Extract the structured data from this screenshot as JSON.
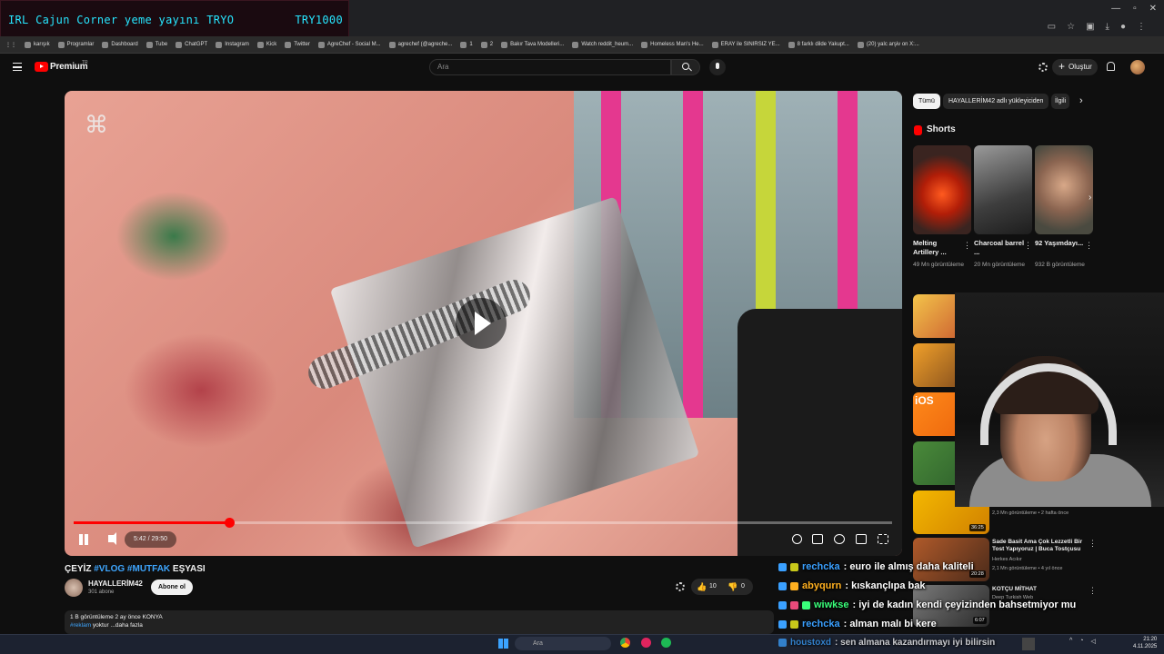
{
  "overlay_banner": {
    "left": "IRL Cajun Corner yeme yayını  TRYO",
    "right": "TRY1000"
  },
  "bookmarks": [
    "karışık",
    "Programlar",
    "Dashboard",
    "Tube",
    "ChatGPT",
    "Instagram",
    "Kick",
    "Twitter",
    "AgreChef - Social M...",
    "agrechef (@agreche...",
    "1",
    "2",
    "Bakır Tava Modelleri...",
    "Watch reddit_heum...",
    "Homeless Man's He...",
    "ERAY ile SINIRSIZ YE...",
    "8 farklı dilde Yakupt...",
    "(20) yalc arşiv on X:..."
  ],
  "yt": {
    "brand": "Premium",
    "region": "TR",
    "search_placeholder": "Ara",
    "create_label": "Oluştur"
  },
  "player": {
    "time": "5:42 / 29:50",
    "progress": 0.19
  },
  "video": {
    "title_prefix": "ÇEYİZ ",
    "tag1": "#VLOG",
    "tag2": "#MUTFAK",
    "title_suffix": " EŞYASI",
    "channel": "HAYALLERİM42",
    "subs": "301 abone",
    "subscribe": "Abone ol",
    "likes": "10",
    "dislikes": "0",
    "desc_line1": "1 B görüntüleme  2 ay önce  KONYA",
    "desc_tag": "#reklam",
    "desc_rest": " yoktur ...daha fazla"
  },
  "chips": [
    "Tümü",
    "HAYALLERİM42 adlı yükleyiciden",
    "İlgili"
  ],
  "shorts": {
    "title": "Shorts",
    "items": [
      {
        "title": "Melting Artillery ...",
        "views": "49 Mn görüntüleme"
      },
      {
        "title": "Charcoal barrel ...",
        "views": "20 Mn görüntüleme"
      },
      {
        "title": "92 Yaşımdayı...",
        "views": "932 B görüntüleme"
      }
    ]
  },
  "recs": [
    {
      "duration": "36:25",
      "title": "",
      "channel": "",
      "meta": "2,3 Mn görüntüleme • 2 hafta önce"
    },
    {
      "duration": "20:28",
      "title": "Sade Basit Ama Çok Lezzetli Bir Tost Yapıyoruz | Buca Tostçusu",
      "channel": "Herkes Acıkır",
      "meta": "2,1 Mn görüntüleme • 4 yıl önce"
    },
    {
      "duration": "6:07",
      "title": "KOTÇU MİTHAT",
      "channel": "Deep Turkish Web",
      "meta": ""
    }
  ],
  "chat": [
    {
      "user": "rechcka",
      "color": "#3aa0ff",
      "msg": ": euro ile almış daha kaliteli"
    },
    {
      "user": "abyqurn",
      "color": "#ffb020",
      "msg": ": kıskançlıpa bak"
    },
    {
      "user": "wiwkse",
      "color": "#3aff7a",
      "msg": ": iyi de kadın kendi çeyizinden bahsetmiyor mu"
    },
    {
      "user": "rechcka",
      "color": "#3aa0ff",
      "msg": ": alman malı bi kere"
    },
    {
      "user": "houstoxd",
      "color": "#3aa0ff",
      "msg": ": sen almana kazandırmayı iyi bilirsin"
    }
  ],
  "taskbar": {
    "search": "Ara",
    "time": "21:20",
    "date": "4.11.2025"
  }
}
